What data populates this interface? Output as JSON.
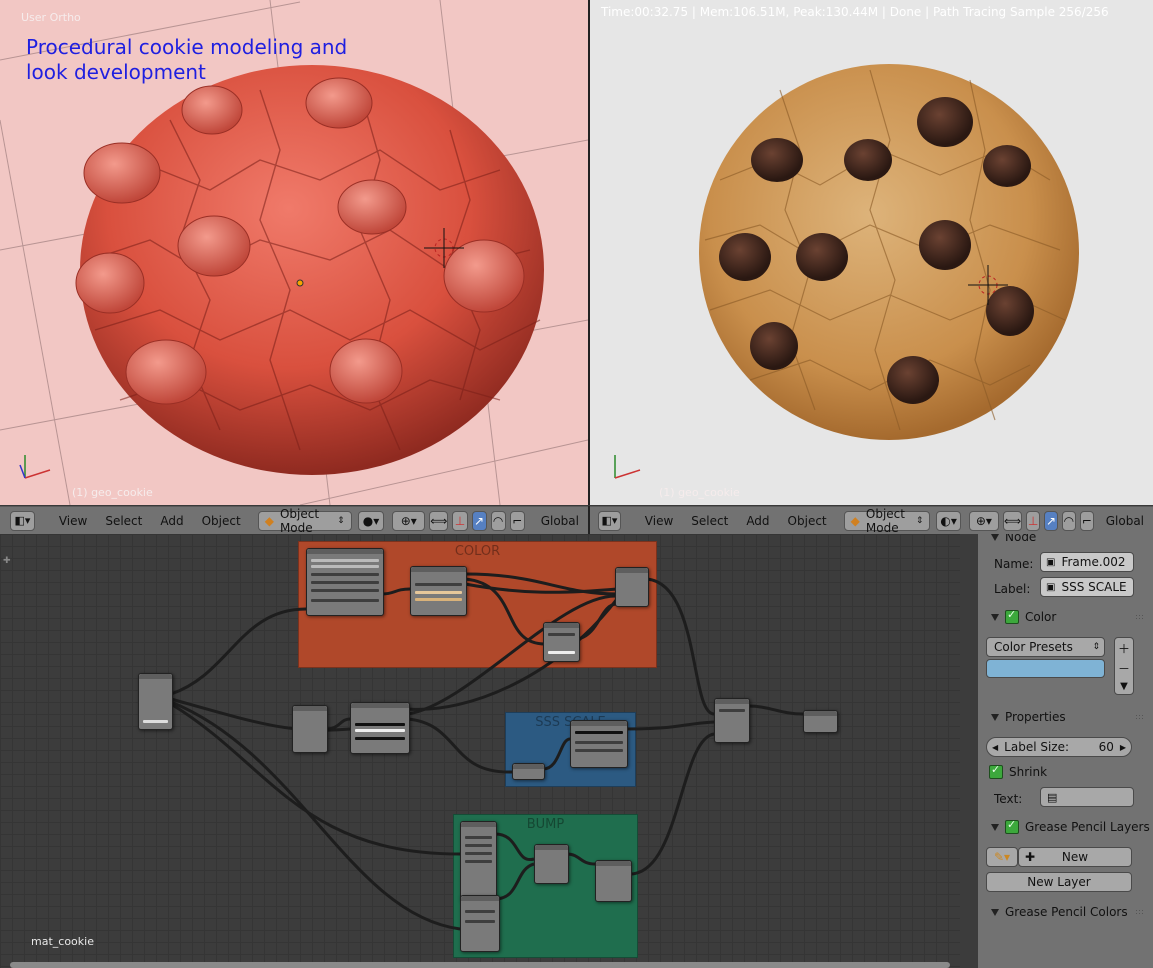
{
  "viewport_left": {
    "view_label": "User Ortho",
    "overlay_title_line1": "Procedural cookie modeling and",
    "overlay_title_line2": "look development",
    "object_label": "(1) geo_cookie"
  },
  "viewport_right": {
    "render_status": "Time:00:32.75 | Mem:106.51M, Peak:130.44M | Done | Path Tracing Sample 256/256",
    "object_label": "(1) geo_cookie"
  },
  "header_left": {
    "menu": [
      "View",
      "Select",
      "Add",
      "Object"
    ],
    "mode": "Object Mode",
    "orientation": "Global"
  },
  "header_right": {
    "menu": [
      "View",
      "Select",
      "Add",
      "Object"
    ],
    "mode": "Object Mode",
    "orientation": "Global"
  },
  "node_editor": {
    "material_name": "mat_cookie",
    "frames": {
      "color": "COLOR",
      "sss": "SSS SCALE",
      "bump": "BUMP"
    }
  },
  "properties": {
    "node_section": "Node",
    "name_label": "Name:",
    "name_value": "Frame.002",
    "label_label": "Label:",
    "label_value": "SSS SCALE",
    "color_section": "Color",
    "color_presets": "Color Presets",
    "swatch_color": "#7fb3d5",
    "properties_section": "Properties",
    "label_size_label": "Label Size:",
    "label_size_value": "60",
    "shrink_label": "Shrink",
    "text_label": "Text:",
    "gp_layers_section": "Grease Pencil Layers",
    "new_button": "New",
    "new_layer_button": "New Layer",
    "gp_colors_section": "Grease Pencil Colors"
  },
  "colors": {
    "frame_color": "#b0482a",
    "frame_sss": "#2c5a82",
    "frame_bump": "#1f6e4e",
    "overlay_text": "#1f1fe0"
  }
}
